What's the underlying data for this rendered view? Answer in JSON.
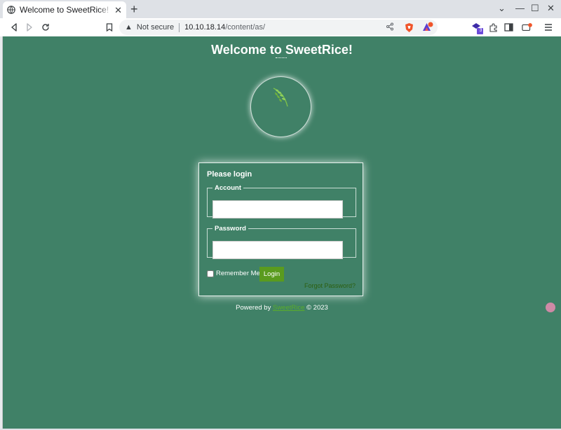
{
  "browser": {
    "tab_title": "Welcome to SweetRice! - Dashboard",
    "close_label": "✕",
    "new_tab_label": "+",
    "security_label": "Not secure",
    "url_host": "10.10.18.14",
    "url_path": "/content/as/",
    "window_controls": {
      "dropdown": "⌄",
      "minimize": "—",
      "maximize": "☐",
      "close": "✕"
    },
    "icons": [
      "back-icon",
      "forward-icon",
      "reload-icon",
      "bookmark-icon",
      "share-icon",
      "brave-shields-icon",
      "brave-rewards-icon",
      "extension-icon",
      "puzzle-icon",
      "sidebar-icon",
      "wallet-icon",
      "menu-icon"
    ],
    "extension_badge": "3"
  },
  "page": {
    "title": "Welcome to SweetRice!",
    "login": {
      "heading": "Please login",
      "account_label": "Account",
      "account_value": "",
      "password_label": "Password",
      "password_value": "",
      "remember_label": "Remember Me",
      "remember_checked": false,
      "login_button": "Login",
      "forgot_link": "Forgot Password?"
    },
    "footer": {
      "prefix": "Powered by",
      "brand": "SweetRice",
      "suffix": "© 2023"
    },
    "colors": {
      "background": "#408167",
      "button": "#5a9b1e",
      "brand": "#5aad2a"
    }
  }
}
